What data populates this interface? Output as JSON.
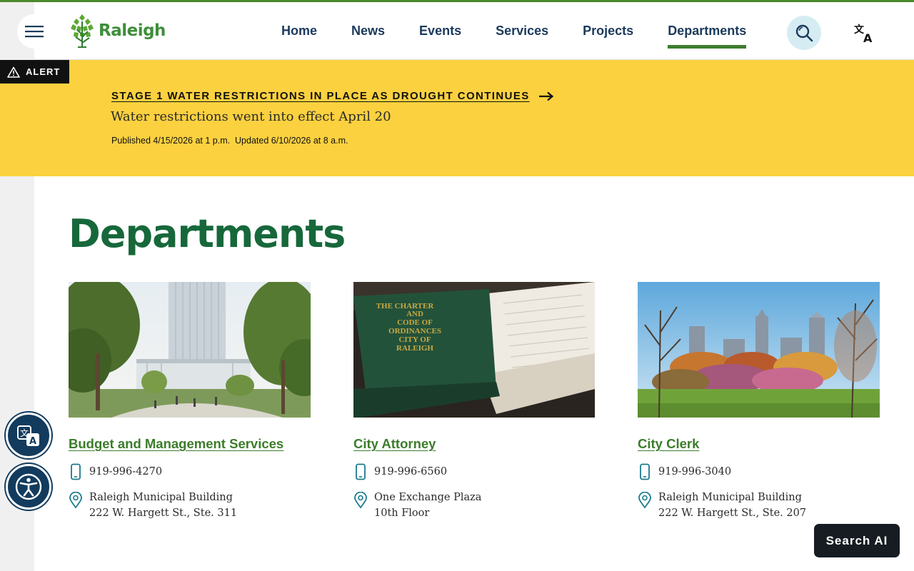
{
  "header": {
    "logo_text": "Raleigh",
    "nav": [
      {
        "label": "Home"
      },
      {
        "label": "News"
      },
      {
        "label": "Events"
      },
      {
        "label": "Services"
      },
      {
        "label": "Projects"
      },
      {
        "label": "Departments",
        "active": true
      }
    ]
  },
  "alert": {
    "tag": "ALERT",
    "headline": "STAGE 1 WATER RESTRICTIONS IN PLACE AS DROUGHT CONTINUES",
    "subtitle": "Water restrictions went into effect April 20",
    "meta": "Published 4/15/2026 at 1 p.m.  Updated 6/10/2026 at 8 a.m."
  },
  "page": {
    "title": "Departments"
  },
  "departments": [
    {
      "name": "Budget and Management Services",
      "phone": "919-996-4270",
      "address_line1": "Raleigh Municipal Building",
      "address_line2": "222 W. Hargett St., Ste. 311"
    },
    {
      "name": "City Attorney",
      "phone": "919-996-6560",
      "address_line1": "One Exchange Plaza",
      "address_line2": "10th Floor",
      "book_text": [
        "THE CHARTER",
        "AND",
        "CODE OF",
        "ORDINANCES",
        "CITY OF",
        "RALEIGH"
      ]
    },
    {
      "name": "City Clerk",
      "phone": "919-996-3040",
      "address_line1": "Raleigh Municipal Building",
      "address_line2": "222 W. Hargett St., Ste. 207"
    }
  ],
  "floating": {
    "search_ai_label": "Search AI"
  },
  "colors": {
    "brand_green": "#16683a",
    "link_green": "#3b7d2a",
    "nav_blue": "#1b3a5c",
    "alert_yellow": "#fcd13f",
    "fab_navy": "#123b5e"
  },
  "icons": {
    "menu": "hamburger-icon",
    "search": "search-icon",
    "translate": "translate-icon",
    "alert": "warning-triangle-icon",
    "arrow": "arrow-right-icon",
    "phone": "mobile-phone-icon",
    "location": "map-pin-icon",
    "accessibility": "accessibility-icon"
  }
}
